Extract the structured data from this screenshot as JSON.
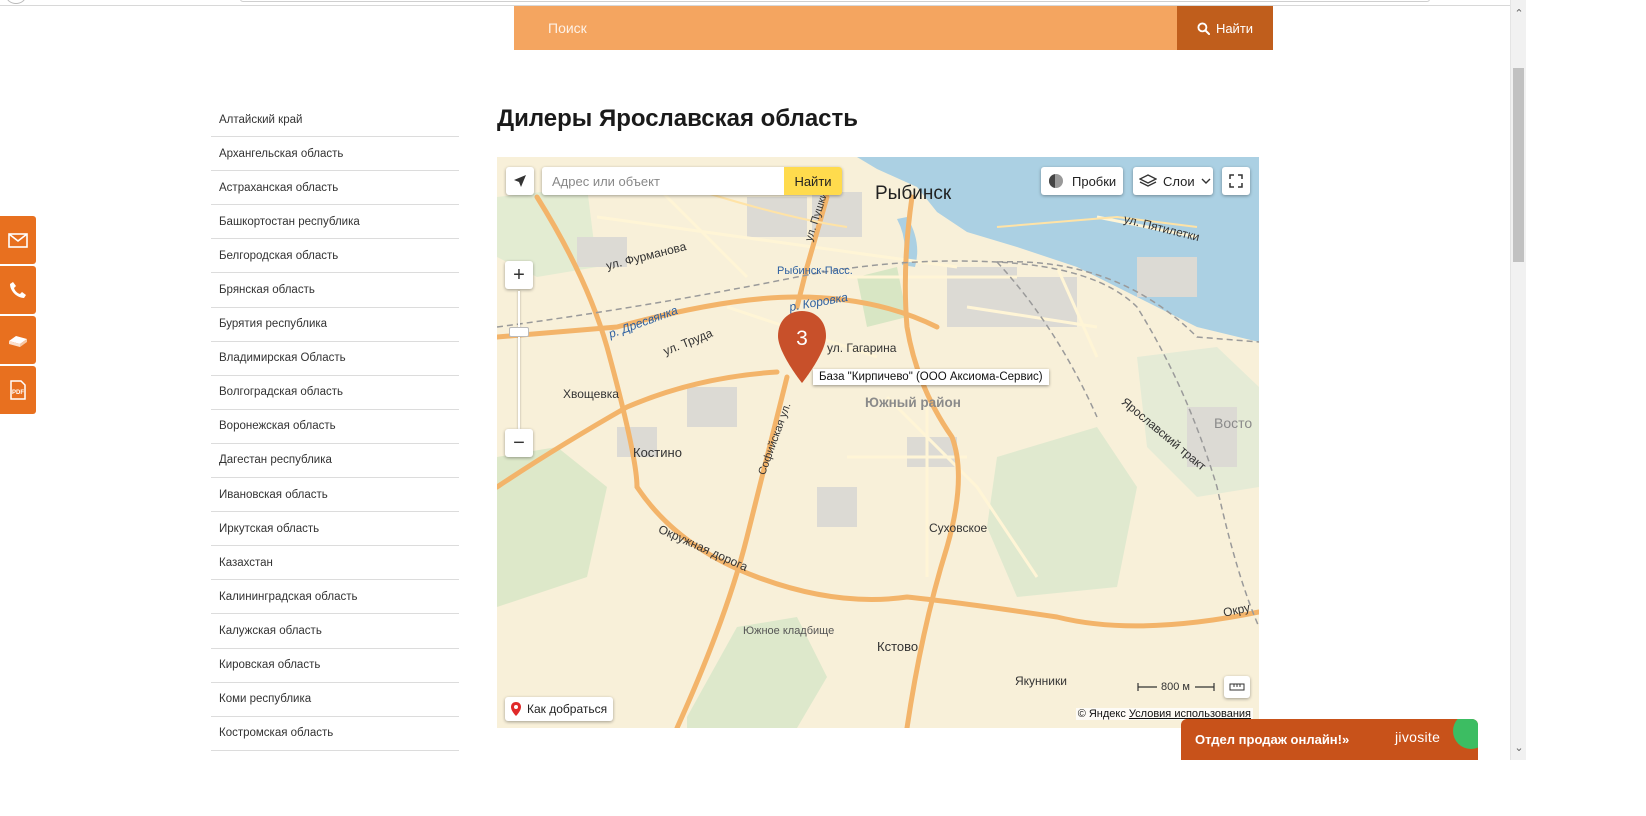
{
  "search": {
    "placeholder": "Поиск",
    "button_label": "Найти"
  },
  "page": {
    "title": "Дилеры Ярославская область"
  },
  "regions": [
    "Алтайский край",
    "Архангельская область",
    "Астраханская область",
    "Башкортостан республика",
    "Белгородская область",
    "Брянская область",
    "Бурятия республика",
    "Владимирская Область",
    "Волгоградская область",
    "Воронежская область",
    "Дагестан республика",
    "Ивановская область",
    "Иркутская область",
    "Казахстан",
    "Калининградская область",
    "Калужская область",
    "Кировская область",
    "Коми республика",
    "Костромская область"
  ],
  "side_buttons": [
    "mail-icon",
    "phone-icon",
    "price-list-icon",
    "pdf-icon"
  ],
  "map": {
    "search_placeholder": "Адрес или объект",
    "search_button": "Найти",
    "traffic_label": "Пробки",
    "layers_label": "Слои",
    "route_label": "Как добраться",
    "marker_count": "3",
    "marker_hint": "База \"Кирпичево\" (ООО Аксиома-Сервис)",
    "scale_label": "800 м",
    "copyright": "© Яндекс",
    "terms_link": "Условия использования",
    "labels": {
      "city": "Рыбинск",
      "fourmanova": "ул. Фурманова",
      "pushkina": "ул. Пушкина",
      "pyatiletki": "ул. Пятилетки",
      "rybinsk_pass": "Рыбинск-Пасс.",
      "korovka": "р. Коровка",
      "dresvyanka": "р. Дресвянка",
      "truda": "ул. Труда",
      "gagarina": "ул. Гагарина",
      "khvoshchevka": "Хвощевка",
      "yuzhny": "Южный район",
      "kostino": "Костино",
      "sofiyskaya": "Софийская ул.",
      "yaroslavsky_trakt": "Ярославский тракт",
      "vostok": "Восто",
      "sukhovskoe": "Суховское",
      "okruzhnaya": "Окружная дорога",
      "okru": "Окру",
      "cemetery": "Южное кладбище",
      "kstovo": "Кстово",
      "yakunniki": "Якунники"
    }
  },
  "chat": {
    "label": "Отдел продаж онлайн!»",
    "brand": "jivosite"
  },
  "colors": {
    "accent": "#e8701f",
    "search_bg": "#f4a560",
    "search_btn": "#c05e1c",
    "marker": "#c8502a"
  }
}
